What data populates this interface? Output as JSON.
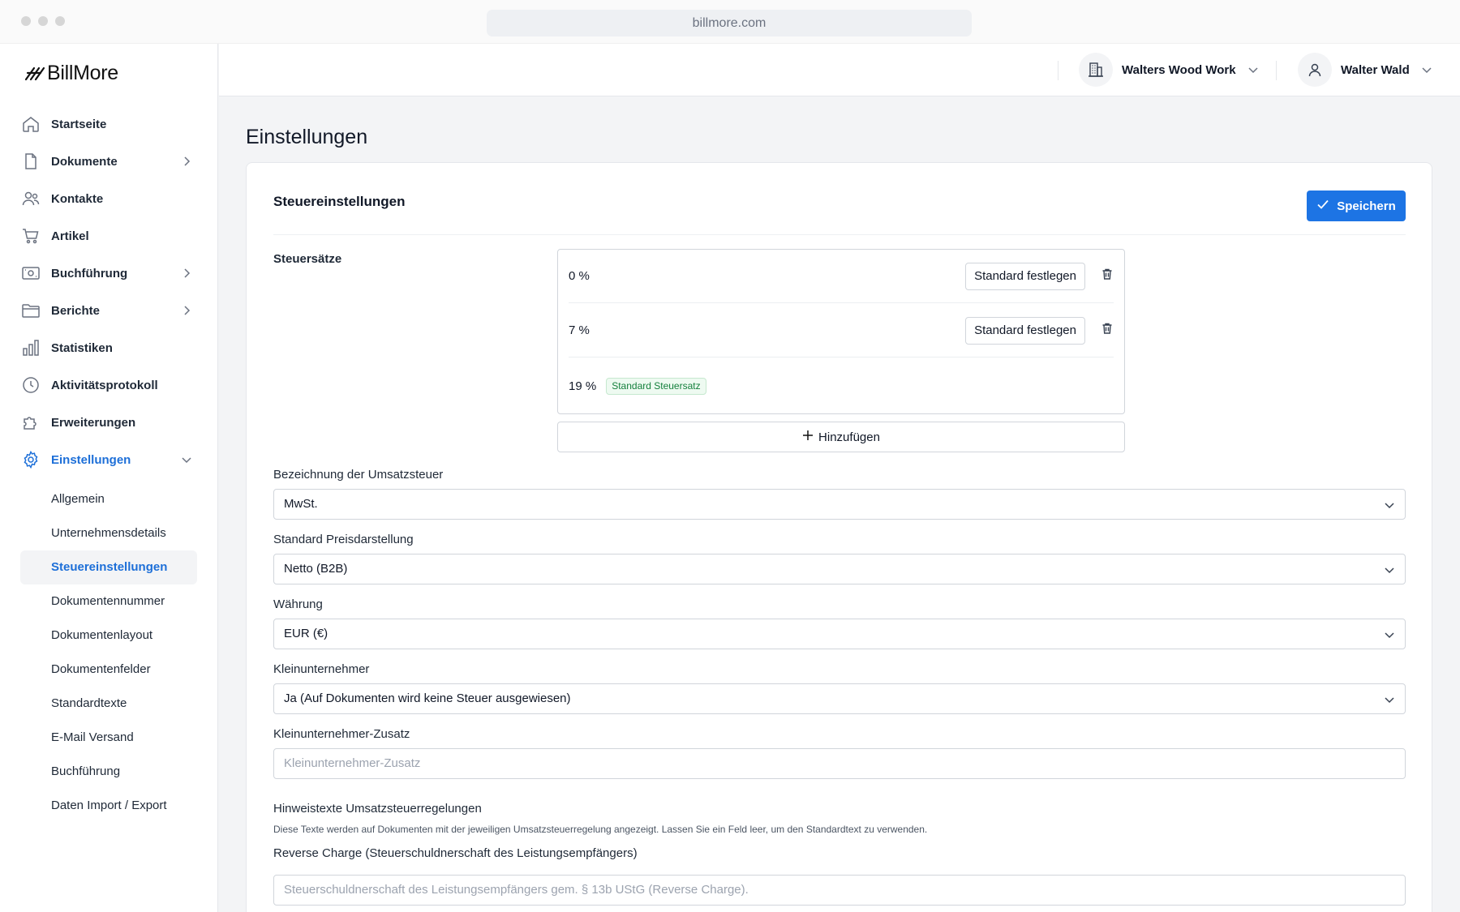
{
  "browser": {
    "url": "billmore.com"
  },
  "app": {
    "logo_text": "BillMore"
  },
  "sidebar": {
    "items": [
      {
        "label": "Startseite"
      },
      {
        "label": "Dokumente"
      },
      {
        "label": "Kontakte"
      },
      {
        "label": "Artikel"
      },
      {
        "label": "Buchführung"
      },
      {
        "label": "Berichte"
      },
      {
        "label": "Statistiken"
      },
      {
        "label": "Aktivitätsprotokoll"
      },
      {
        "label": "Erweiterungen"
      },
      {
        "label": "Einstellungen"
      }
    ],
    "sub_items": [
      {
        "label": "Allgemein"
      },
      {
        "label": "Unternehmensdetails"
      },
      {
        "label": "Steuereinstellungen"
      },
      {
        "label": "Dokumentennummer"
      },
      {
        "label": "Dokumentenlayout"
      },
      {
        "label": "Dokumentenfelder"
      },
      {
        "label": "Standardtexte"
      },
      {
        "label": "E-Mail Versand"
      },
      {
        "label": "Buchführung"
      },
      {
        "label": "Daten Import / Export"
      }
    ]
  },
  "header": {
    "company": "Walters Wood Work",
    "user": "Walter Wald"
  },
  "page": {
    "title": "Einstellungen",
    "section_title": "Steuereinstellungen",
    "save_label": "Speichern",
    "tax_rates_label": "Steuersätze",
    "tax_rates": [
      {
        "value": "0 %",
        "action": "Standard festlegen"
      },
      {
        "value": "7 %",
        "action": "Standard festlegen"
      },
      {
        "value": "19 %",
        "badge": "Standard Steuersatz"
      }
    ],
    "add_label": "Hinzufügen",
    "vat_name": {
      "label": "Bezeichnung der Umsatzsteuer",
      "value": "MwSt."
    },
    "price_display": {
      "label": "Standard Preisdarstellung",
      "value": "Netto (B2B)"
    },
    "currency": {
      "label": "Währung",
      "value": "EUR (€)"
    },
    "small_business": {
      "label": "Kleinunternehmer",
      "value": "Ja (Auf Dokumenten wird keine Steuer ausgewiesen)"
    },
    "small_business_note": {
      "label": "Kleinunternehmer-Zusatz",
      "placeholder": "Kleinunternehmer-Zusatz"
    },
    "hints": {
      "label": "Hinweistexte Umsatzsteuerregelungen",
      "description": "Diese Texte werden auf Dokumenten mit der jeweiligen Umsatzsteuerregelung angezeigt. Lassen Sie ein Feld leer, um den Standardtext zu verwenden."
    },
    "reverse_charge": {
      "label": "Reverse Charge (Steuerschuldnerschaft des Leistungsempfängers)",
      "placeholder": "Steuerschuldnerschaft des Leistungsempfängers gem. § 13b UStG (Reverse Charge)."
    }
  },
  "colors": {
    "accent": "#1d74e4",
    "active_nav": "#1d6fd8",
    "badge_text": "#15803d"
  }
}
